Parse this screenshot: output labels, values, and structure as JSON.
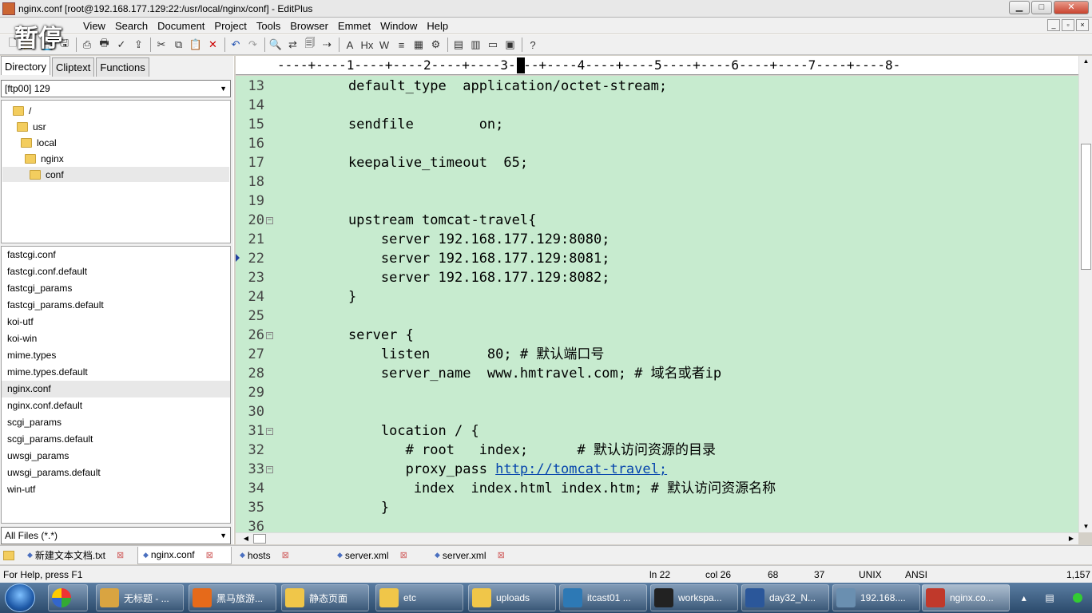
{
  "window": {
    "title": "nginx.conf [root@192.168.177.129:22:/usr/local/nginx/conf] - EditPlus",
    "buttons": {
      "minimize": "▁",
      "maximize": "□",
      "close": "✕"
    }
  },
  "overlay_text": "暂停",
  "menu": [
    "View",
    "Search",
    "Document",
    "Project",
    "Tools",
    "Browser",
    "Emmet",
    "Window",
    "Help"
  ],
  "mdi_buttons": [
    "_",
    "▫",
    "×"
  ],
  "left_panel": {
    "tabs": [
      "Directory",
      "Cliptext",
      "Functions"
    ],
    "drive": "[ftp00] 129",
    "tree": [
      "/",
      "usr",
      "local",
      "nginx",
      "conf"
    ],
    "files": [
      "fastcgi.conf",
      "fastcgi.conf.default",
      "fastcgi_params",
      "fastcgi_params.default",
      "koi-utf",
      "koi-win",
      "mime.types",
      "mime.types.default",
      "nginx.conf",
      "nginx.conf.default",
      "scgi_params",
      "scgi_params.default",
      "uwsgi_params",
      "uwsgi_params.default",
      "win-utf"
    ],
    "selected_file": "nginx.conf",
    "filter": "All Files (*.*)"
  },
  "ruler": "----+----1----+----2----+----3----+----4----+----5----+----6----+----7----+----8-",
  "editor": {
    "background": "#c7ebcf",
    "lines": [
      {
        "n": "13",
        "code": "    default_type  application/octet-stream;"
      },
      {
        "n": "14",
        "code": ""
      },
      {
        "n": "15",
        "code": "    sendfile        on;"
      },
      {
        "n": "16",
        "code": ""
      },
      {
        "n": "17",
        "code": "    keepalive_timeout  65;"
      },
      {
        "n": "18",
        "code": ""
      },
      {
        "n": "19",
        "code": ""
      },
      {
        "n": "20",
        "code": "    upstream tomcat-travel{",
        "fold": true
      },
      {
        "n": "21",
        "code": "        server 192.168.177.129:8080;"
      },
      {
        "n": "22",
        "code": "        server 192.168.177.129:8081;",
        "marker": true
      },
      {
        "n": "23",
        "code": "        server 192.168.177.129:8082;"
      },
      {
        "n": "24",
        "code": "    }"
      },
      {
        "n": "25",
        "code": ""
      },
      {
        "n": "26",
        "code": "    server {",
        "fold": true
      },
      {
        "n": "27",
        "code": "        listen       80; # 默认端口号"
      },
      {
        "n": "28",
        "code": "        server_name  www.hmtravel.com; # 域名或者ip"
      },
      {
        "n": "29",
        "code": ""
      },
      {
        "n": "30",
        "code": ""
      },
      {
        "n": "31",
        "code": "        location / {",
        "fold": true
      },
      {
        "n": "32",
        "code": "           # root   index;      # 默认访问资源的目录"
      },
      {
        "n": "33",
        "code": "           proxy_pass ",
        "link": "http://tomcat-travel;",
        "fold": true
      },
      {
        "n": "34",
        "code": "            index  index.html index.htm; # 默认访问资源名称"
      },
      {
        "n": "35",
        "code": "        }"
      },
      {
        "n": "36",
        "code": ""
      }
    ]
  },
  "doc_tabs": [
    {
      "label": "新建文本文档.txt",
      "active": false
    },
    {
      "label": "nginx.conf",
      "active": true
    },
    {
      "label": "hosts",
      "active": false
    },
    {
      "label": "server.xml",
      "active": false
    },
    {
      "label": "server.xml",
      "active": false
    }
  ],
  "status": {
    "help": "For Help, press F1",
    "line": "ln 22",
    "col": "col 26",
    "total": "68",
    "f4": "37",
    "eol": "UNIX",
    "encoding": "ANSI",
    "size": "1,157"
  },
  "taskbar": {
    "apps": [
      {
        "label": "无标题 - ...",
        "color": "#d9a441"
      },
      {
        "label": "黑马旅游...",
        "color": "#e66a1a"
      },
      {
        "label": "静态页面",
        "color": "#f0c649"
      },
      {
        "label": "etc",
        "color": "#f0c649"
      },
      {
        "label": "uploads",
        "color": "#f0c649"
      },
      {
        "label": "itcast01 ...",
        "color": "#2d79b5"
      },
      {
        "label": "workspa...",
        "color": "#222222"
      },
      {
        "label": "day32_N...",
        "color": "#2b579a"
      },
      {
        "label": "192.168....",
        "color": "#6a8fb0"
      },
      {
        "label": "nginx.co...",
        "color": "#c0392b",
        "active": true
      }
    ]
  }
}
